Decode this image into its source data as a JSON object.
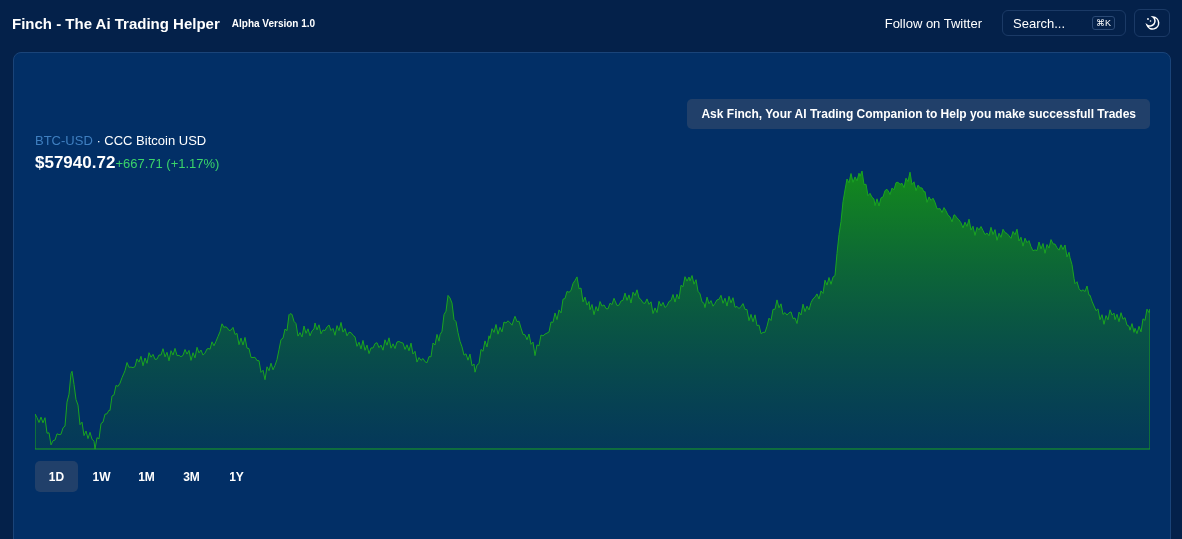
{
  "header": {
    "title": "Finch - The Ai Trading Helper",
    "version": "Alpha Version 1.0",
    "link": "Follow on Twitter",
    "search": {
      "placeholder": "Search...",
      "shortcut": "⌘K"
    }
  },
  "ticker": {
    "symbol": "BTC-USD",
    "name": "· CCC Bitcoin USD",
    "price": "$57940.72",
    "change": "+667.71 (+1.17%)"
  },
  "ask_button": "Ask Finch, Your AI Trading Companion to Help you make successfull Trades",
  "ranges": [
    {
      "label": "1D",
      "selected": true
    },
    {
      "label": "1W",
      "selected": false
    },
    {
      "label": "1M",
      "selected": false
    },
    {
      "label": "3M",
      "selected": false
    },
    {
      "label": "1Y",
      "selected": false
    }
  ]
}
